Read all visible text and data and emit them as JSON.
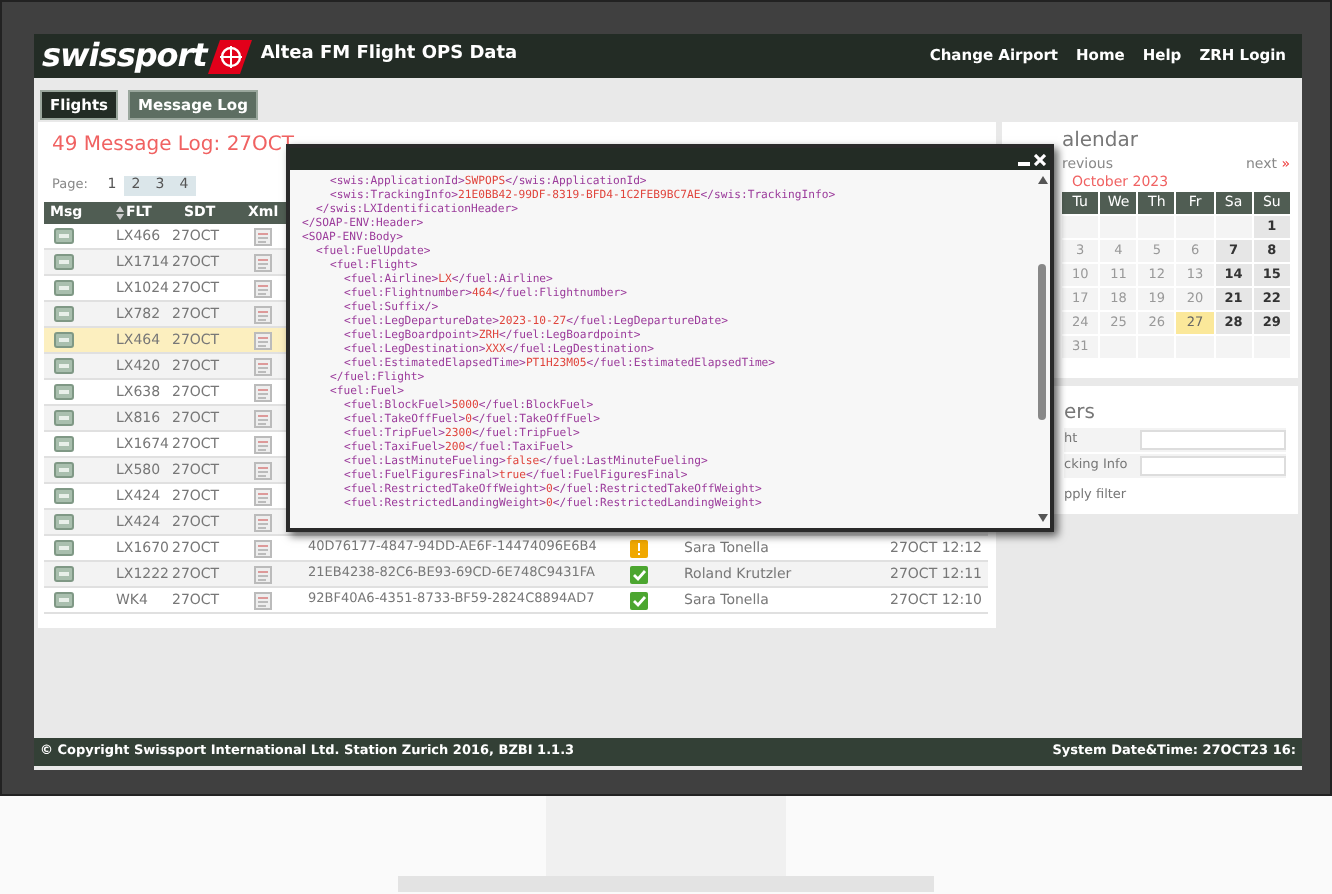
{
  "header": {
    "logo": "swissport",
    "title": "Altea FM Flight OPS Data",
    "links": [
      "Change Airport",
      "Home",
      "Help",
      "ZRH Login"
    ]
  },
  "tabs": [
    {
      "label": "Flights",
      "selected": true
    },
    {
      "label": "Message Log",
      "selected": false
    }
  ],
  "log": {
    "title": "49 Message Log: 27OCT",
    "page_label": "Page:",
    "pages": [
      {
        "label": "1",
        "selected": true
      },
      {
        "label": "2",
        "selected": false
      },
      {
        "label": "3",
        "selected": false
      },
      {
        "label": "4",
        "selected": false
      }
    ],
    "columns": [
      "Msg",
      "FLT",
      "SDT",
      "Xml"
    ],
    "rows": [
      {
        "flight": "LX466",
        "sdt": "27OCT",
        "selected": false
      },
      {
        "flight": "LX1714",
        "sdt": "27OCT",
        "selected": false
      },
      {
        "flight": "LX1024",
        "sdt": "27OCT",
        "selected": false
      },
      {
        "flight": "LX782",
        "sdt": "27OCT",
        "selected": false
      },
      {
        "flight": "LX464",
        "sdt": "27OCT",
        "selected": true
      },
      {
        "flight": "LX420",
        "sdt": "27OCT",
        "selected": false
      },
      {
        "flight": "LX638",
        "sdt": "27OCT",
        "selected": false
      },
      {
        "flight": "LX816",
        "sdt": "27OCT",
        "selected": false
      },
      {
        "flight": "LX1674",
        "sdt": "27OCT",
        "selected": false
      },
      {
        "flight": "LX580",
        "sdt": "27OCT",
        "selected": false
      },
      {
        "flight": "LX424",
        "sdt": "27OCT",
        "selected": false
      },
      {
        "flight": "LX424",
        "sdt": "27OCT",
        "selected": false
      },
      {
        "flight": "LX1670",
        "sdt": "27OCT",
        "selected": false,
        "tracking": "40D76177-4847-94DD-AE6F-14474096E6B4",
        "kind": "warning",
        "user": "Sara Tonella",
        "time": "27OCT 12:12"
      },
      {
        "flight": "LX1222",
        "sdt": "27OCT",
        "selected": false,
        "tracking": "21EB4238-82C6-BE93-69CD-6E748C9431FA",
        "kind": "ok",
        "user": "Roland Krutzler",
        "time": "27OCT 12:11"
      },
      {
        "flight": "WK4",
        "sdt": "27OCT",
        "selected": false,
        "tracking": "92BF40A6-4351-8733-BF59-2824C8894AD7",
        "kind": "ok",
        "user": "Sara Tonella",
        "time": "27OCT 12:10"
      }
    ]
  },
  "xml_popup": {
    "lines": [
      {
        "children": [
          {
            "children": [
              {
                "tag": "<swis:ApplicationId>",
                "value": "SWPOPS",
                "end": "</swis:ApplicationId>"
              },
              {
                "tag": "<swis:TrackingInfo>",
                "value": "21E0BB42-99DF-8319-BFD4-1C2FEB9BC7AE",
                "end": "</swis:TrackingInfo>"
              }
            ]
          },
          {
            "tag": "</swis:LXIdentificationHeader>"
          }
        ]
      },
      {
        "tag": "</SOAP-ENV:Header>"
      },
      {
        "tag": "<SOAP-ENV:Body>",
        "children": [
          {
            "tag": "<fuel:FuelUpdate>",
            "children": [
              {
                "tag": "<fuel:Flight>",
                "children": [
                  {
                    "tag": "<fuel:Airline>",
                    "value": "LX",
                    "end": "</fuel:Airline>"
                  },
                  {
                    "tag": "<fuel:Flightnumber>",
                    "value": "464",
                    "end": "</fuel:Flightnumber>"
                  },
                  {
                    "tag": "<fuel:Suffix/>"
                  },
                  {
                    "tag": "<fuel:LegDepartureDate>",
                    "value": "2023-10-27",
                    "end": "</fuel:LegDepartureDate>"
                  },
                  {
                    "tag": "<fuel:LegBoardpoint>",
                    "value": "ZRH",
                    "end": "</fuel:LegBoardpoint>"
                  },
                  {
                    "tag": "<fuel:LegDestination>",
                    "value": "XXX",
                    "end": "</fuel:LegDestination>"
                  },
                  {
                    "tag": "<fuel:EstimatedElapsedTime>",
                    "value": "PT1H23M05",
                    "end": "</fuel:EstimatedElapsedTime>"
                  }
                ]
              },
              {
                "tag": "</fuel:Flight>"
              },
              {
                "tag": "<fuel:Fuel>",
                "children": [
                  {
                    "tag": "<fuel:BlockFuel>",
                    "value": "5000",
                    "end": "</fuel:BlockFuel>"
                  },
                  {
                    "tag": "<fuel:TakeOffFuel>",
                    "value": "0",
                    "end": "</fuel:TakeOffFuel>"
                  },
                  {
                    "tag": "<fuel:TripFuel>",
                    "value": "2300",
                    "end": "</fuel:TripFuel>"
                  },
                  {
                    "tag": "<fuel:TaxiFuel>",
                    "value": "200",
                    "end": "</fuel:TaxiFuel>"
                  },
                  {
                    "tag": "<fuel:LastMinuteFueling>",
                    "value": "false",
                    "end": "</fuel:LastMinuteFueling>"
                  },
                  {
                    "tag": "<fuel:FuelFiguresFinal>",
                    "value": "true",
                    "end": "</fuel:FuelFiguresFinal>"
                  },
                  {
                    "tag": "<fuel:RestrictedTakeOffWeight>",
                    "value": "0",
                    "end": "</fuel:RestrictedTakeOffWeight>"
                  },
                  {
                    "tag": "<fuel:RestrictedLandingWeight>",
                    "value": "0",
                    "end": "</fuel:RestrictedLandingWeight>"
                  }
                ]
              }
            ]
          }
        ]
      }
    ]
  },
  "calendar": {
    "title": "alendar",
    "previous": "revious",
    "next": "next",
    "next_mark": "»",
    "month": "October 2023",
    "weekdays": [
      "Tu",
      "We",
      "Th",
      "Fr",
      "Sa",
      "Su"
    ],
    "weeks": [
      [
        {
          "label": "1",
          "selected": false
        }
      ],
      [
        {
          "label": "3",
          "selected": false
        },
        {
          "label": "4",
          "selected": false
        },
        {
          "label": "5",
          "selected": false
        },
        {
          "label": "6",
          "selected": false
        },
        {
          "label": "7",
          "selected": false
        },
        {
          "label": "8",
          "selected": false
        }
      ],
      [
        {
          "label": "10",
          "selected": false
        },
        {
          "label": "11",
          "selected": false
        },
        {
          "label": "12",
          "selected": false
        },
        {
          "label": "13",
          "selected": false
        },
        {
          "label": "14",
          "selected": false
        },
        {
          "label": "15",
          "selected": false
        }
      ],
      [
        {
          "label": "17",
          "selected": false
        },
        {
          "label": "18",
          "selected": false
        },
        {
          "label": "19",
          "selected": false
        },
        {
          "label": "20",
          "selected": false
        },
        {
          "label": "21",
          "selected": false
        },
        {
          "label": "22",
          "selected": false
        }
      ],
      [
        {
          "label": "24",
          "selected": false
        },
        {
          "label": "25",
          "selected": false
        },
        {
          "label": "26",
          "selected": false
        },
        {
          "label": "27",
          "selected": true
        },
        {
          "label": "28",
          "selected": false
        },
        {
          "label": "29",
          "selected": false
        }
      ],
      [
        {
          "label": "31",
          "selected": false
        }
      ]
    ]
  },
  "filters": {
    "title": "ers",
    "fields": [
      {
        "label": "ht"
      },
      {
        "label": "cking Info"
      }
    ],
    "apply": "pply filter"
  },
  "footer": {
    "copyright": "© Copyright Swissport International Ltd. Station Zurich 2016, BZBI 1.1.3",
    "system_time": "System Date&Time: 27OCT23 16:"
  }
}
